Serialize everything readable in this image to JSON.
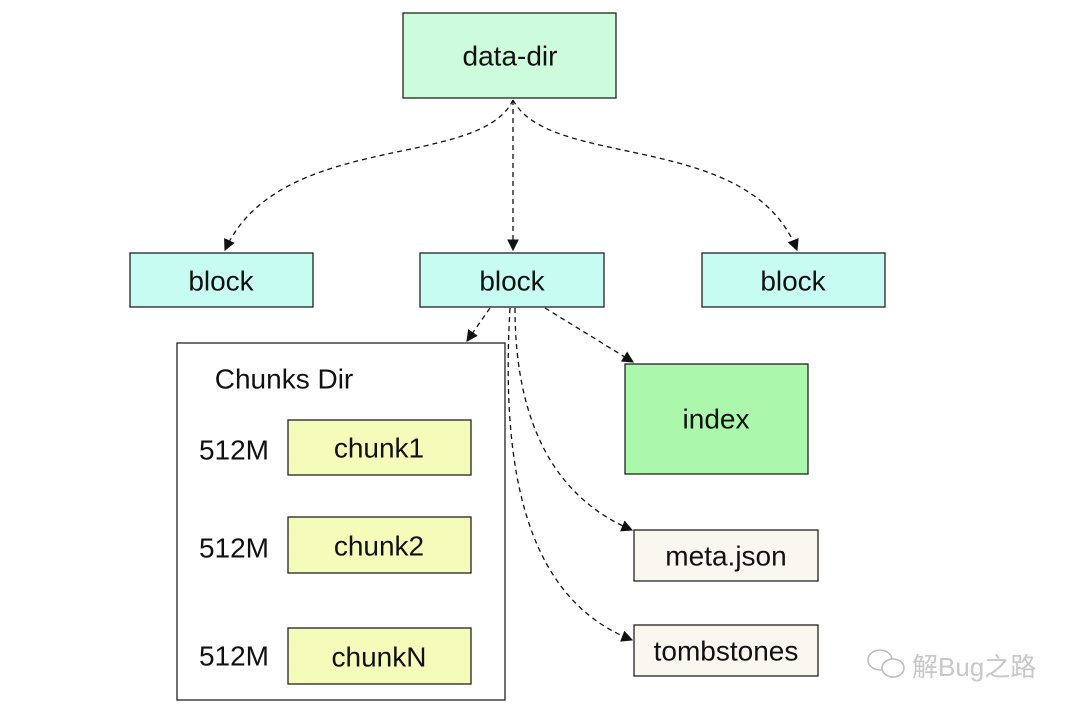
{
  "nodes": {
    "data_dir": "data-dir",
    "block_left": "block",
    "block_center": "block",
    "block_right": "block",
    "chunks_dir": "Chunks Dir",
    "chunk1": "chunk1",
    "chunk2": "chunk2",
    "chunkN": "chunkN",
    "size1": "512M",
    "size2": "512M",
    "sizeN": "512M",
    "index": "index",
    "meta": "meta.json",
    "tombstones": "tombstones"
  },
  "watermark": "解Bug之路",
  "colors": {
    "data_dir": "#ccfcdc",
    "block": "#c6fcf1",
    "index": "#abf7ab",
    "chunk": "#f5fcb9",
    "file": "#faf6f0"
  }
}
